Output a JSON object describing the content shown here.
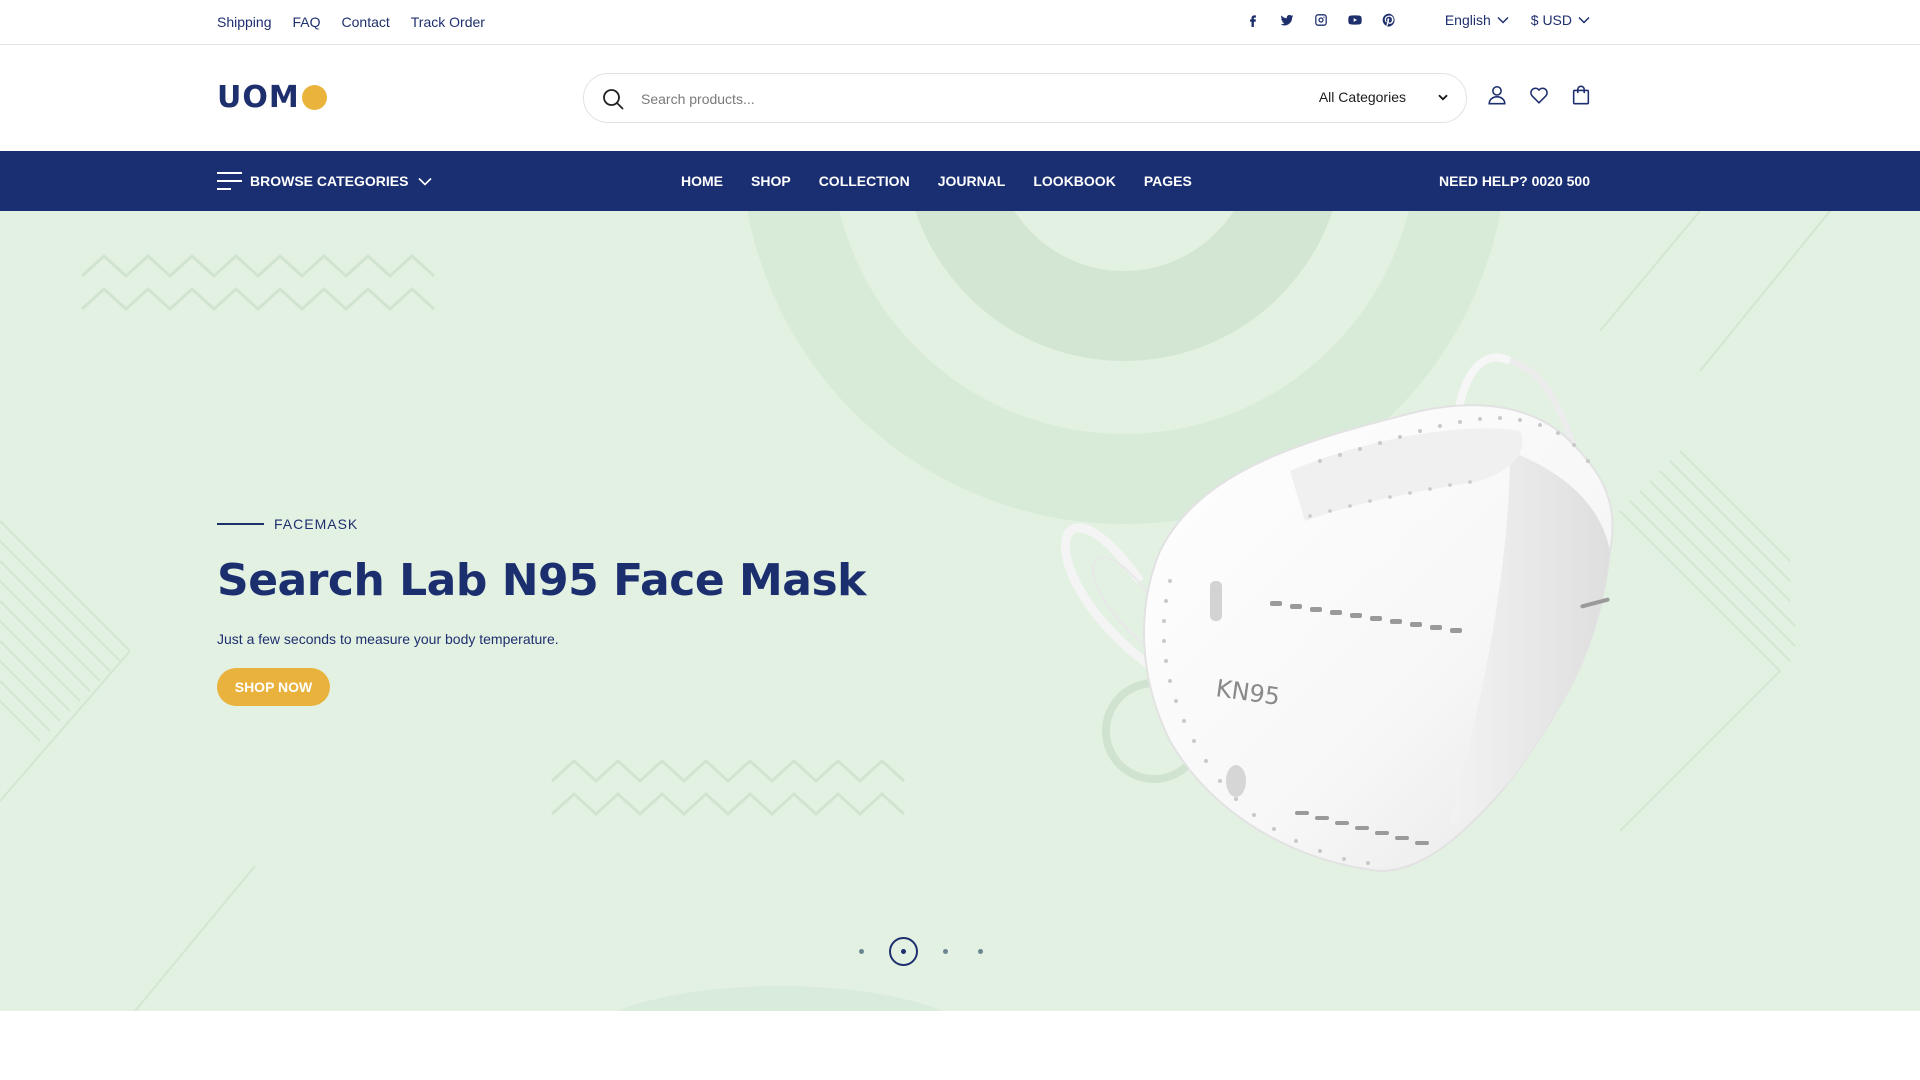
{
  "topbar": {
    "links": [
      "Shipping",
      "FAQ",
      "Contact",
      "Track Order"
    ],
    "social_icons": [
      "facebook-icon",
      "twitter-icon",
      "instagram-icon",
      "youtube-icon",
      "pinterest-icon"
    ],
    "language": "English",
    "currency": "$ USD"
  },
  "header": {
    "logo_text": "UOM",
    "search_placeholder": "Search products...",
    "category_select": "All Categories",
    "icons": [
      "user-icon",
      "heart-icon",
      "bag-icon"
    ]
  },
  "nav": {
    "browse_label": "BROWSE CATEGORIES",
    "items": [
      "HOME",
      "SHOP",
      "COLLECTION",
      "JOURNAL",
      "LOOKBOOK",
      "PAGES"
    ],
    "help_text": "NEED HELP? 0020 500"
  },
  "hero": {
    "eyebrow": "FACEMASK",
    "title": "Search Lab N95 Face Mask",
    "subtitle": "Just a few seconds to measure your body temperature.",
    "cta": "SHOP NOW",
    "mask_print": "KN95",
    "slide_count": 4,
    "active_slide": 2
  },
  "colors": {
    "navy": "#1a2f72",
    "accent": "#eab43c",
    "hero_bg": "#e3f1e3"
  }
}
